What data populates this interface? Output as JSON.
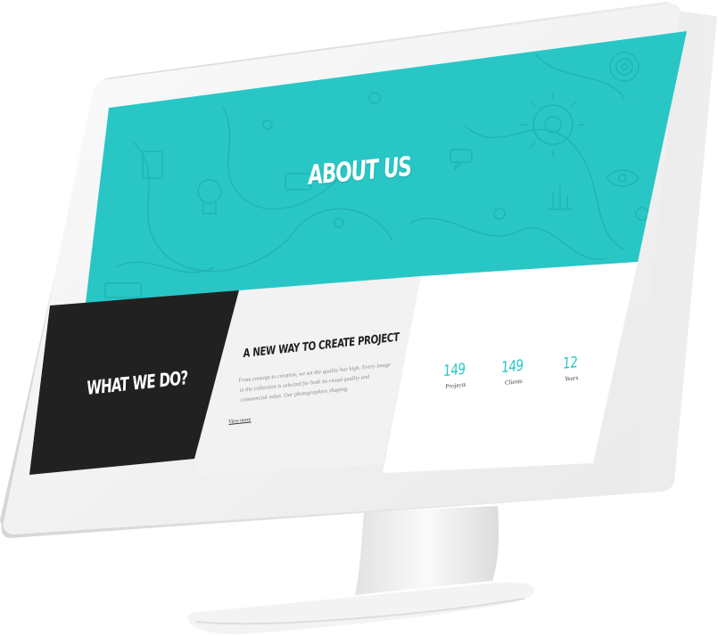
{
  "hero": {
    "title": "ABOUT US"
  },
  "what_we_do": {
    "heading": "WHAT WE DO?"
  },
  "project": {
    "heading": "A NEW WAY TO CREATE PROJECT",
    "paragraph": "From concept to creation, we set the quality bar high. Every image in the collection is selected for both its visual quality and commercial value. Our photographers shaping.",
    "link": "View more"
  },
  "stats": [
    {
      "value": "149",
      "label": "Projects"
    },
    {
      "value": "149",
      "label": "Clients"
    },
    {
      "value": "12",
      "label": "Years"
    }
  ],
  "colors": {
    "accent": "#29c6c6",
    "dark_panel": "#212121",
    "light_panel": "#f2f2f2",
    "white_panel": "#ffffff",
    "monitor_frame": "#f4f4f4"
  },
  "icons": [
    "gear-icon",
    "lightbulb-icon",
    "eye-icon",
    "target-icon",
    "chart-icon",
    "chat-bubble-icon"
  ]
}
